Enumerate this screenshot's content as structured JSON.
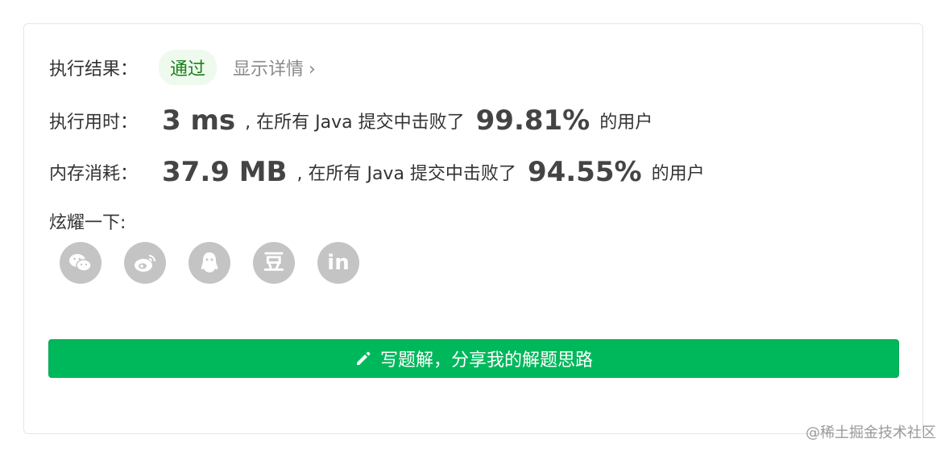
{
  "result": {
    "label": "执行结果：",
    "status": "通过",
    "details_link": "显示详情",
    "details_chevron": "›"
  },
  "runtime": {
    "label": "执行用时：",
    "value": "3 ms",
    "middle_text": ", 在所有 Java 提交中击败了",
    "percent": "99.81%",
    "suffix": "的用户"
  },
  "memory": {
    "label": "内存消耗：",
    "value": "37.9 MB",
    "middle_text": ", 在所有 Java 提交中击败了",
    "percent": "94.55%",
    "suffix": "的用户"
  },
  "share": {
    "label": "炫耀一下:",
    "icons": [
      {
        "name": "wechat-icon"
      },
      {
        "name": "weibo-icon"
      },
      {
        "name": "qq-icon"
      },
      {
        "name": "douban-icon",
        "glyph": "豆"
      },
      {
        "name": "linkedin-icon",
        "glyph": "in"
      }
    ],
    "icon_color": "#c4c4c4"
  },
  "write_solution": {
    "label": "写题解，分享我的解题思路",
    "icon": "pencil-icon",
    "color": "#00b85c"
  },
  "watermark": "@稀土掘金技术社区"
}
